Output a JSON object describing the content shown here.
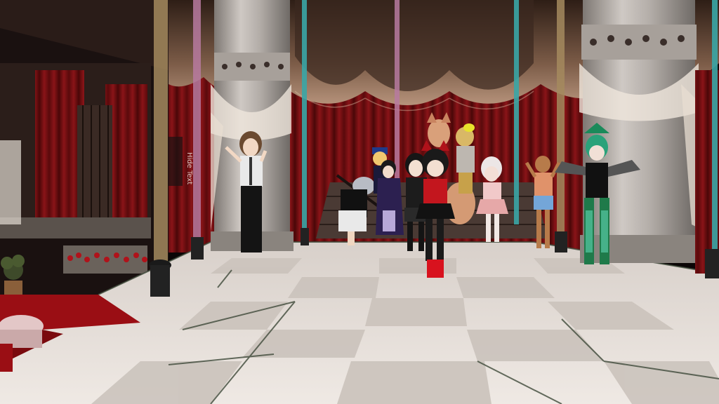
{
  "scene": {
    "title": "",
    "mirror_sign_lines": [
      "Hide",
      "Text"
    ]
  },
  "palette": {
    "curtain_red": "#7a0f12",
    "drape_beige": "#c9ab95",
    "pillar_stone": "#b9b3ae",
    "floor_light": "#e3dcd6",
    "floor_dark": "#cfc7c0",
    "pole_teal": "#3aa6a6",
    "pole_pink": "#b77aa0",
    "pole_gold": "#a58a5e"
  },
  "avatars": [
    {
      "name": "brown-hair-waving-avatar"
    },
    {
      "name": "maid-bowing-avatar"
    },
    {
      "name": "blue-hat-avatar"
    },
    {
      "name": "purple-coat-avatar"
    },
    {
      "name": "dark-hair-avatar"
    },
    {
      "name": "red-black-fox-girl-avatar"
    },
    {
      "name": "fox-tail-avatar"
    },
    {
      "name": "blonde-avatar"
    },
    {
      "name": "white-hair-avatar"
    },
    {
      "name": "tan-girl-avatar"
    },
    {
      "name": "green-armor-avatar"
    }
  ]
}
